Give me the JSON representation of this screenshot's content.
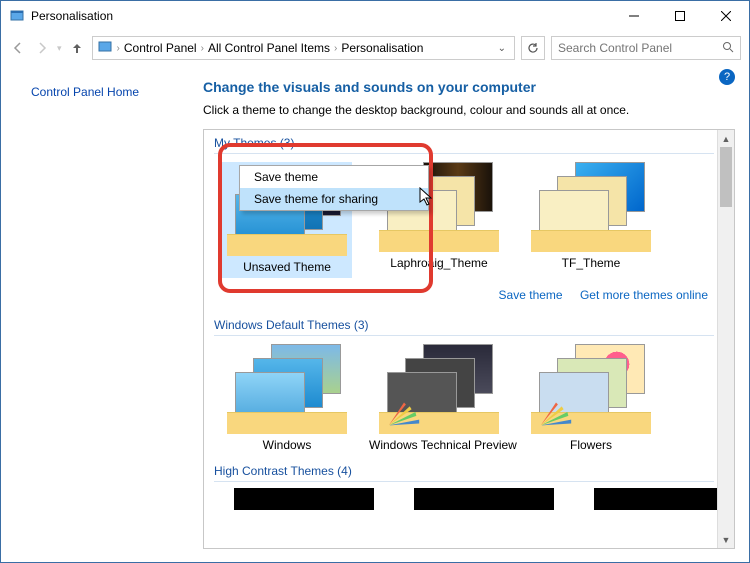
{
  "window": {
    "title": "Personalisation"
  },
  "breadcrumbs": {
    "a": "Control Panel",
    "b": "All Control Panel Items",
    "c": "Personalisation"
  },
  "search": {
    "placeholder": "Search Control Panel"
  },
  "leftnav": {
    "home": "Control Panel Home"
  },
  "main": {
    "heading": "Change the visuals and sounds on your computer",
    "sub": "Click a theme to change the desktop background, colour and sounds all at once."
  },
  "groups": {
    "my": "My Themes (3)",
    "default": "Windows Default Themes (3)",
    "hc": "High Contrast Themes (4)"
  },
  "themes": {
    "unsaved": "Unsaved Theme",
    "laphroaig": "Laphroaig_Theme",
    "tf": "TF_Theme",
    "windows": "Windows",
    "wtp": "Windows Technical Preview",
    "flowers": "Flowers"
  },
  "links": {
    "save": "Save theme",
    "getmore": "Get more themes online"
  },
  "context_menu": {
    "item1": "Save theme",
    "item2": "Save theme for sharing"
  },
  "help": "?"
}
